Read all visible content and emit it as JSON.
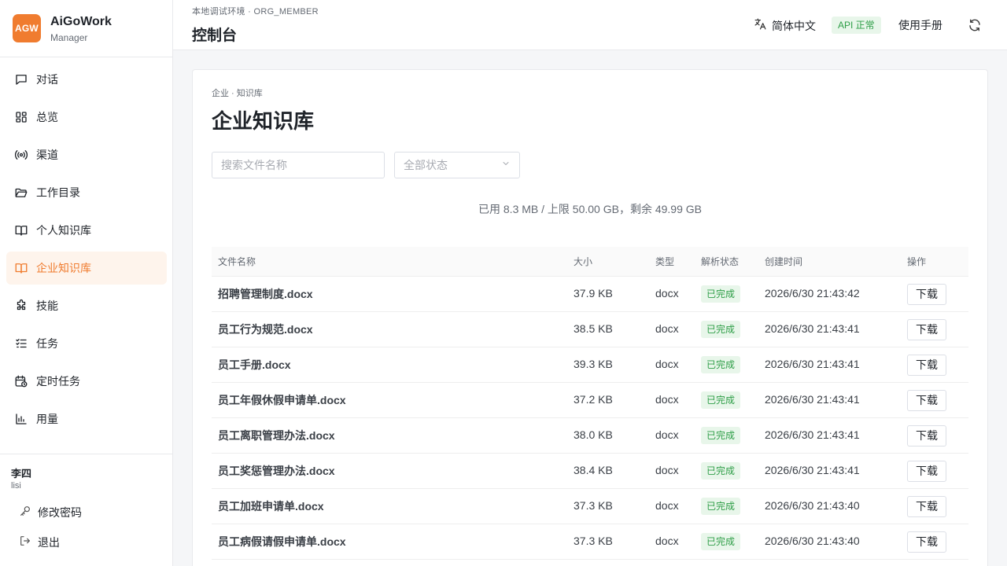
{
  "brand": {
    "logo": "AGW",
    "name": "AiGoWork",
    "sub": "Manager",
    "accent": "#f07c2f"
  },
  "nav": [
    {
      "label": "对话",
      "icon": "chat-icon"
    },
    {
      "label": "总览",
      "icon": "dashboard-icon"
    },
    {
      "label": "渠道",
      "icon": "broadcast-icon"
    },
    {
      "label": "工作目录",
      "icon": "folder-icon"
    },
    {
      "label": "个人知识库",
      "icon": "book-icon"
    },
    {
      "label": "企业知识库",
      "icon": "book-icon",
      "active": true
    },
    {
      "label": "技能",
      "icon": "puzzle-icon"
    },
    {
      "label": "任务",
      "icon": "checklist-icon"
    },
    {
      "label": "定时任务",
      "icon": "calendar-clock-icon"
    },
    {
      "label": "用量",
      "icon": "bar-chart-icon"
    }
  ],
  "user": {
    "name": "李四",
    "id": "lisi",
    "change_password": "修改密码",
    "logout": "退出"
  },
  "header": {
    "env": "本地调试环境 · ORG_MEMBER",
    "title": "控制台",
    "language": "简体中文",
    "api_status": "API 正常",
    "manual": "使用手册"
  },
  "page": {
    "breadcrumb": "企业 · 知识库",
    "title": "企业知识库",
    "search_placeholder": "搜索文件名称",
    "status_filter": "全部状态",
    "quota": "已用 8.3 MB / 上限 50.00 GB，剩余 49.99 GB"
  },
  "table": {
    "headers": {
      "name": "文件名称",
      "size": "大小",
      "type": "类型",
      "status": "解析状态",
      "created": "创建时间",
      "action": "操作"
    },
    "rows": [
      {
        "name": "招聘管理制度.docx",
        "size": "37.9 KB",
        "type": "docx",
        "status": "已完成",
        "created": "2026/6/30 21:43:42",
        "action": "下载"
      },
      {
        "name": "员工行为规范.docx",
        "size": "38.5 KB",
        "type": "docx",
        "status": "已完成",
        "created": "2026/6/30 21:43:41",
        "action": "下载"
      },
      {
        "name": "员工手册.docx",
        "size": "39.3 KB",
        "type": "docx",
        "status": "已完成",
        "created": "2026/6/30 21:43:41",
        "action": "下载"
      },
      {
        "name": "员工年假休假申请单.docx",
        "size": "37.2 KB",
        "type": "docx",
        "status": "已完成",
        "created": "2026/6/30 21:43:41",
        "action": "下载"
      },
      {
        "name": "员工离职管理办法.docx",
        "size": "38.0 KB",
        "type": "docx",
        "status": "已完成",
        "created": "2026/6/30 21:43:41",
        "action": "下载"
      },
      {
        "name": "员工奖惩管理办法.docx",
        "size": "38.4 KB",
        "type": "docx",
        "status": "已完成",
        "created": "2026/6/30 21:43:41",
        "action": "下载"
      },
      {
        "name": "员工加班申请单.docx",
        "size": "37.3 KB",
        "type": "docx",
        "status": "已完成",
        "created": "2026/6/30 21:43:40",
        "action": "下载"
      },
      {
        "name": "员工病假请假申请单.docx",
        "size": "37.3 KB",
        "type": "docx",
        "status": "已完成",
        "created": "2026/6/30 21:43:40",
        "action": "下载"
      }
    ]
  }
}
